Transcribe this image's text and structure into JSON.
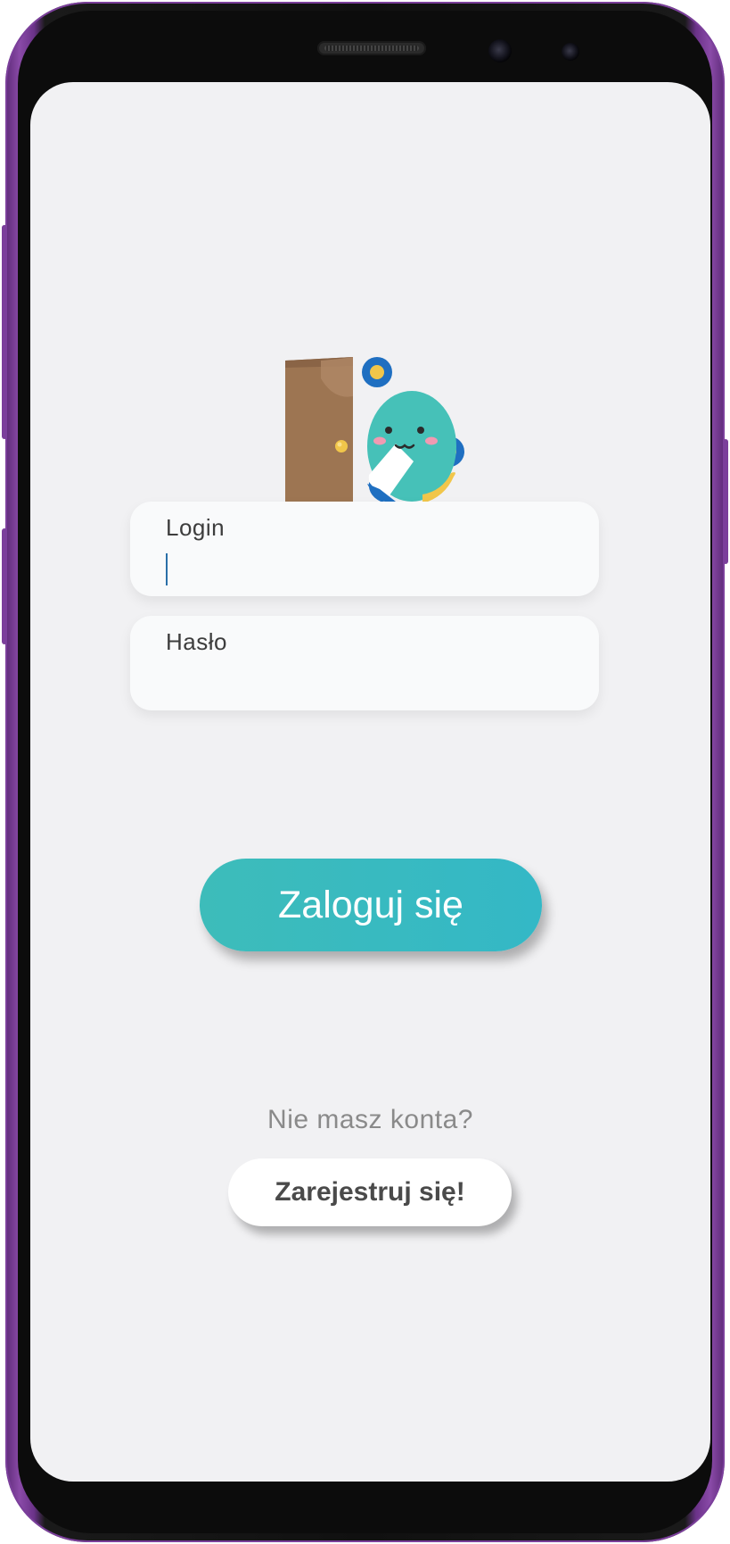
{
  "login_form": {
    "login_label": "Login",
    "login_value": "",
    "password_label": "Hasło",
    "password_value": ""
  },
  "login_button": {
    "label": "Zaloguj się"
  },
  "register": {
    "prompt": "Nie masz konta?",
    "button_label": "Zarejestruj się!"
  },
  "logo": {
    "icon": "door-mascot-icon"
  },
  "colors": {
    "accent": "#3dbcba",
    "device_frame": "#7b3f9b",
    "screen_background": "#f1f1f3",
    "door": "#9d7552",
    "mascot": "#46c1b8"
  }
}
